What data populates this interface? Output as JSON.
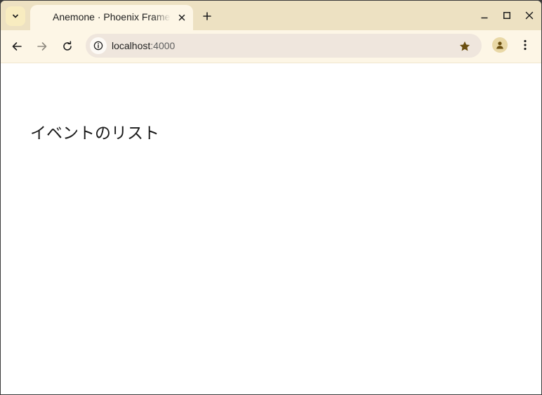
{
  "browser": {
    "tab": {
      "title": "Anemone · Phoenix Framework"
    },
    "address_bar": {
      "host": "localhost",
      "port": ":4000"
    },
    "icons": {
      "tab_search": "chevron-down-icon",
      "tab_close": "close-icon",
      "new_tab": "plus-icon",
      "minimize": "minimize-icon",
      "maximize": "maximize-icon",
      "close_window": "close-icon",
      "back": "arrow-left-icon",
      "forward": "arrow-right-icon",
      "reload": "reload-icon",
      "site_info": "info-icon",
      "bookmark": "star-icon",
      "profile": "person-icon",
      "menu": "kebab-menu-icon"
    },
    "colors": {
      "tabstrip": "#ede1c2",
      "toolbar": "#fdf6e6",
      "bookmark_star": "#6b4f10"
    }
  },
  "page": {
    "heading": "イベントのリスト"
  }
}
